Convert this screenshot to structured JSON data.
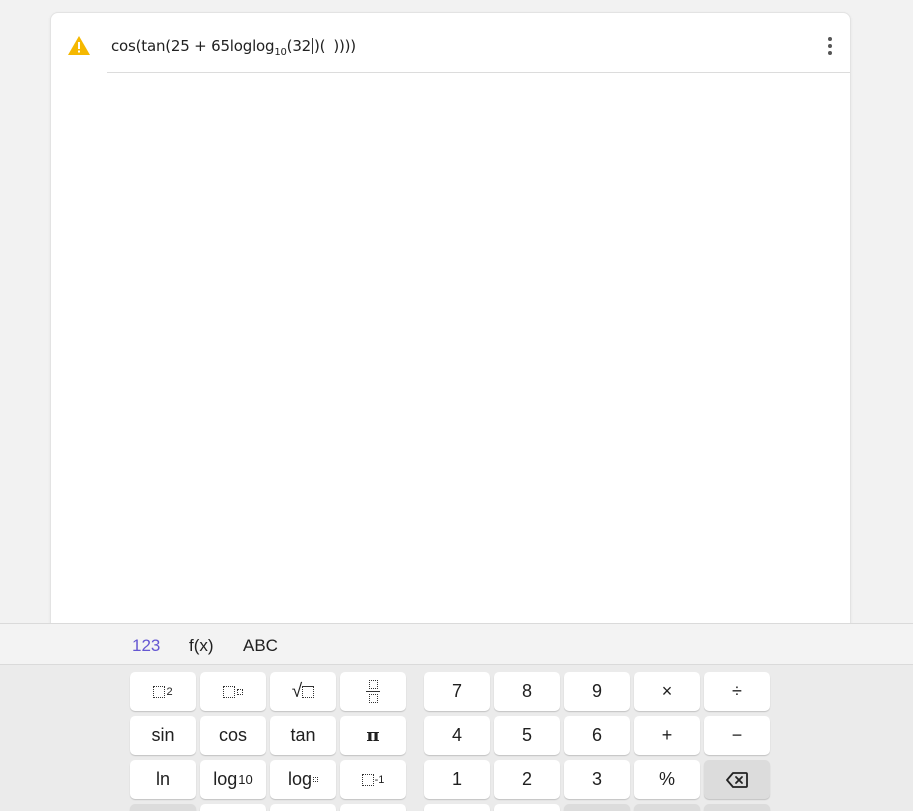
{
  "algebra": {
    "formula": {
      "p1": "cos(tan(25 + 65loglog",
      "sub": "10",
      "p2": "(32",
      "p3": ")(",
      "p4": "))))"
    }
  },
  "keyboard": {
    "tabs": [
      "123",
      "f(x)",
      "ABC"
    ],
    "active_tab": "123",
    "keys": {
      "square_sup": "2",
      "sqrt_symbol": "√",
      "sin": "sin",
      "cos": "cos",
      "tan": "tan",
      "pi": "π",
      "ln": "ln",
      "log10_base": "log",
      "log10_sub": "10",
      "logb_base": "log",
      "inverse_sup": "-1",
      "n7": "7",
      "n8": "8",
      "n9": "9",
      "times": "×",
      "divide": "÷",
      "n4": "4",
      "n5": "5",
      "n6": "6",
      "plus": "+",
      "minus": "−",
      "n1": "1",
      "n2": "2",
      "n3": "3",
      "percent": "%"
    }
  },
  "colors": {
    "accent": "#6557d2",
    "warning": "#f5b800"
  }
}
